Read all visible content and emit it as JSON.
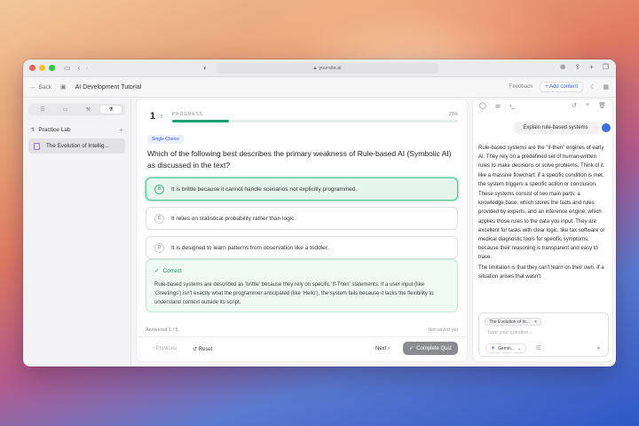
{
  "browser": {
    "url": "yoursite.ai"
  },
  "header": {
    "back_label": "Back",
    "course_title": "AI Development Tutorial",
    "feedback_label": "Feedback",
    "add_content_label": "Add content"
  },
  "sidebar": {
    "section_title": "Practice Lab",
    "items": [
      {
        "label": "The Evolution of Intellig..."
      }
    ]
  },
  "quiz": {
    "progress_current": "1",
    "progress_total": "/ 5",
    "progress_label": "PROGRESS",
    "progress_percent": "20%",
    "progress_fraction": 0.2,
    "type_badge": "Single Choice",
    "question": "Which of the following best describes the primary weakness of Rule-based AI (Symbolic AI) as discussed in the text?",
    "options": [
      {
        "letter": "B",
        "text": "It is brittle because it cannot handle scenarios not explicitly programmed.",
        "state": "correct"
      },
      {
        "letter": "C",
        "text": "It relies on statistical probability rather than logic.",
        "state": "default"
      },
      {
        "letter": "D",
        "text": "It is designed to learn patterns from observation like a toddler.",
        "state": "default"
      }
    ],
    "feedback_title": "Correct",
    "feedback_text": "Rule-based systems are described as 'brittle' because they rely on specific 'If-Then' statements. If a user input (like 'Greetings') isn't exactly what the programmer anticipated (like 'Hello'), the system fails because it lacks the flexibility to understand context outside its script.",
    "answered": "Answered 1 / 5",
    "save_status": "Not saved yet",
    "previous_label": "Previous",
    "reset_label": "Reset",
    "next_label": "Next",
    "complete_label": "Complete Quiz"
  },
  "chat": {
    "user_message": "Explain rule-based systems",
    "reply_paragraphs": [
      "Rule-based systems are the \"if-then\" engines of early AI. They rely on a predefined set of human-written rules to make decisions or solve problems. Think of it like a massive flowchart: if a specific condition is met, the system triggers a specific action or conclusion.",
      "These systems consist of two main parts: a knowledge base, which stores the facts and rules provided by experts, and an inference engine, which applies those rules to the data you input. They are excellent for tasks with clear logic, like tax software or medical diagnostic tools for specific symptoms, because their reasoning is transparent and easy to trace.",
      "The limitation is that they can't learn on their own. If a situation arises that wasn't"
    ],
    "context_chip": "The Evolution of In...",
    "input_placeholder": "Type your question...",
    "model_label": "Gemin..."
  }
}
